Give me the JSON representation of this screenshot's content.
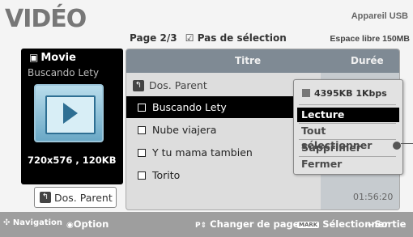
{
  "header": {
    "title": "VIDÉO",
    "device": "Appareil USB",
    "page_info": "Page 2/3",
    "selection": "Pas de sélection",
    "free_space": "Espace libre 150MB"
  },
  "info": {
    "type_label": "Movie",
    "file_name": "Buscando Lety",
    "resolution": "720x576 , 120KB"
  },
  "parent_button": "Dos. Parent",
  "list": {
    "col_title": "Titre",
    "col_duration": "Durée",
    "parent_row": "Dos. Parent",
    "items": [
      {
        "name": "Buscando Lety"
      },
      {
        "name": "Nube viajera"
      },
      {
        "name": "Y tu mama tambien"
      },
      {
        "name": "Torito"
      }
    ],
    "partial_duration": "01:56:20"
  },
  "popup": {
    "info": "4395KB 1Kbps",
    "items": [
      "Lecture",
      "Tout sélectionner",
      "Supprimer",
      "Fermer"
    ],
    "active": "Lecture"
  },
  "footer": {
    "navigation": "Navigation",
    "option": "Option",
    "page_change": "Changer de page",
    "mark_key": "MARK",
    "select": "Sélectionner",
    "exit": "Sortie"
  }
}
